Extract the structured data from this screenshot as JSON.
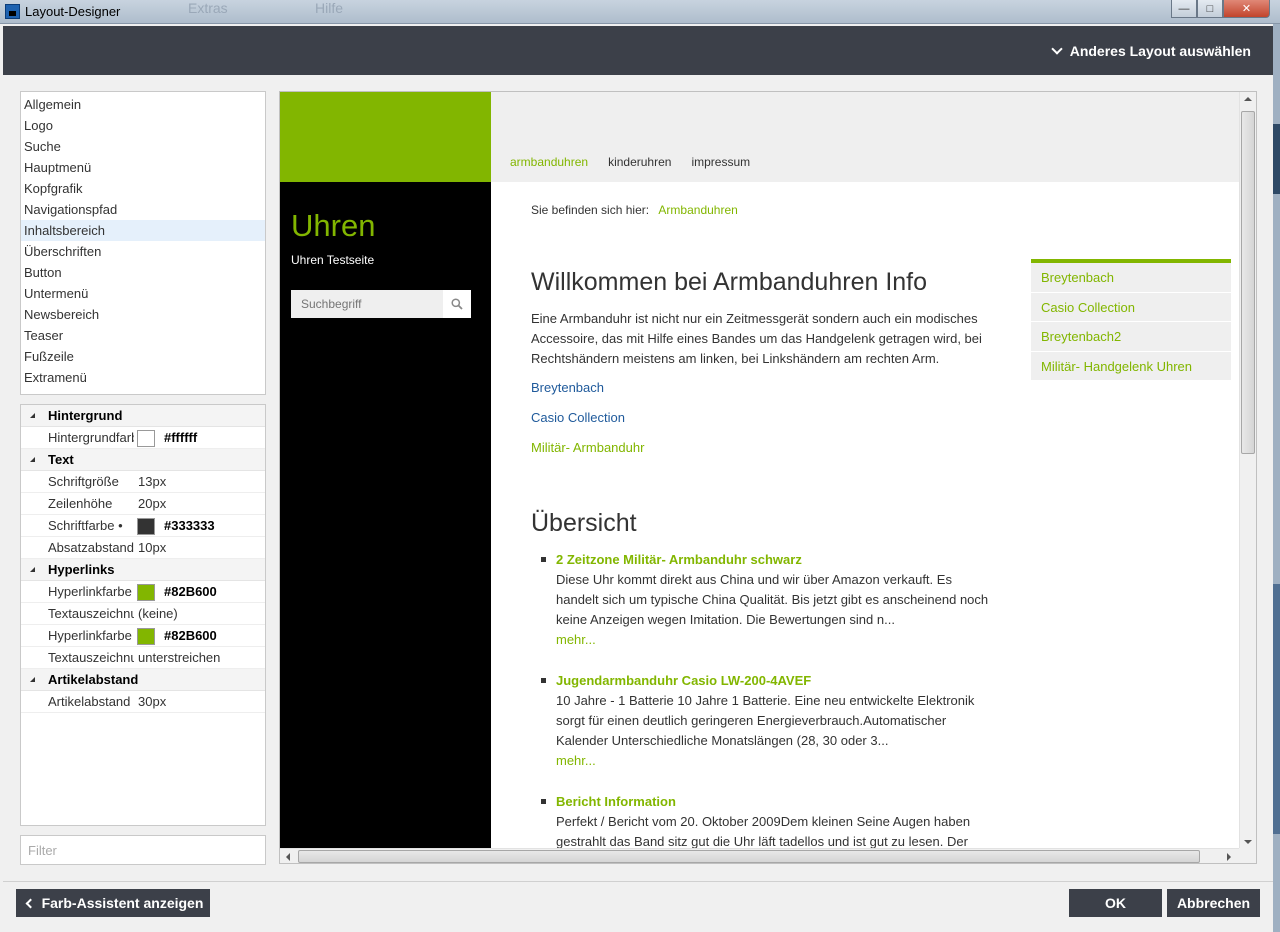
{
  "window": {
    "title": "Layout-Designer",
    "bg_menu_ghost": [
      "Extras",
      "Hilfe"
    ]
  },
  "header": {
    "layout_switch_label": "Anderes Layout auswählen"
  },
  "menu": {
    "items": [
      {
        "label": "Allgemein"
      },
      {
        "label": "Logo"
      },
      {
        "label": "Suche"
      },
      {
        "label": "Hauptmenü"
      },
      {
        "label": "Kopfgrafik"
      },
      {
        "label": "Navigationspfad"
      },
      {
        "label": "Inhaltsbereich",
        "selected": true
      },
      {
        "label": "Überschriften"
      },
      {
        "label": "Button"
      },
      {
        "label": "Untermenü"
      },
      {
        "label": "Newsbereich"
      },
      {
        "label": "Teaser"
      },
      {
        "label": "Fußzeile"
      },
      {
        "label": "Extramenü"
      }
    ]
  },
  "props": {
    "background": {
      "title": "Hintergrund",
      "color_label": "Hintergrundfarbe",
      "color_value": "#ffffff"
    },
    "text": {
      "title": "Text",
      "size_label": "Schriftgröße",
      "size_value": "13px",
      "lineheight_label": "Zeilenhöhe",
      "lineheight_value": "20px",
      "color_label": "Schriftfarbe •",
      "color_value": "#333333",
      "para_label": "Absatzabstand",
      "para_value": "10px"
    },
    "links": {
      "title": "Hyperlinks",
      "color_label": "Hyperlinkfarbe",
      "color_value": "#82B600",
      "deco_label": "Textauszeichnung",
      "deco_value": "(keine)",
      "hover_color_label": "Hyperlinkfarbe",
      "hover_color_value": "#82B600",
      "hover_deco_label": "Textauszeichnung",
      "hover_deco_value": "unterstreichen"
    },
    "article": {
      "title": "Artikelabstand",
      "spacing_label": "Artikelabstand",
      "spacing_value": "30px"
    }
  },
  "filter": {
    "placeholder": "Filter"
  },
  "preview": {
    "nav": [
      "armbanduhren",
      "kinderuhren",
      "impressum"
    ],
    "site_title": "Uhren",
    "site_subtitle": "Uhren Testseite",
    "search_placeholder": "Suchbegriff",
    "breadcrumb_label": "Sie befinden sich hier:",
    "breadcrumb_link": "Armbanduhren",
    "heading": "Willkommen bei Armbanduhren Info",
    "intro": "Eine Armbanduhr ist nicht nur ein Zeitmessgerät sondern auch ein modisches Accessoire, das mit Hilfe eines Bandes um das Handgelenk getragen wird, bei Rechtshändern meistens am linken, bei Linkshändern am rechten Arm.",
    "links": [
      "Breytenbach",
      "Casio Collection",
      "Militär- Armbanduhr"
    ],
    "overview_heading": "Übersicht",
    "articles": [
      {
        "title": "2 Zeitzone Militär- Armbanduhr schwarz",
        "text": "Diese Uhr kommt direkt aus China und wir über Amazon verkauft. Es handelt sich um typische China Qualität. Bis jetzt gibt es anscheinend noch keine Anzeigen wegen Imitation. Die Bewertungen sind n...",
        "more": "mehr..."
      },
      {
        "title": "Jugendarmbanduhr Casio LW-200-4AVEF",
        "text": "10 Jahre - 1 Batterie 10 Jahre 1 Batterie. Eine neu entwickelte Elektronik sorgt für einen deutlich geringeren Energieverbrauch.Automatischer Kalender Unterschiedliche Monatslängen (28, 30 oder 3...",
        "more": "mehr..."
      },
      {
        "title": "Bericht Information",
        "text": "Perfekt / Bericht vom 20. Oktober 2009Dem kleinen Seine Augen haben gestrahlt das Band sitz gut die Uhr läft tadellos und ist gut zu lesen. Der",
        "more": ""
      }
    ],
    "side_menu": [
      "Breytenbach",
      "Casio Collection",
      "Breytenbach2",
      "Militär- Handgelenk Uhren"
    ]
  },
  "footer": {
    "assistant_label": "Farb-Assistent anzeigen",
    "ok_label": "OK",
    "cancel_label": "Abbrechen"
  },
  "colors": {
    "accent": "#82B600",
    "dark_bar": "#3c4049",
    "link_blue": "#1f5a9b"
  }
}
